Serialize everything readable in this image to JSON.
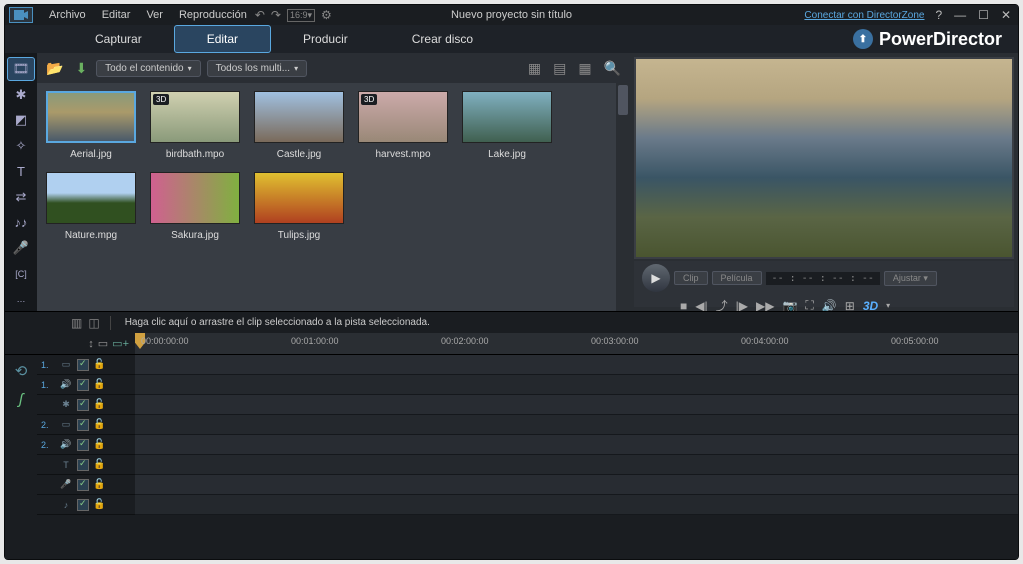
{
  "menu": {
    "archivo": "Archivo",
    "editar": "Editar",
    "ver": "Ver",
    "reproduccion": "Reproducción"
  },
  "title": "Nuevo proyecto sin título",
  "link_dz": "Conectar con DirectorZone",
  "modes": {
    "capturar": "Capturar",
    "editar": "Editar",
    "producir": "Producir",
    "crear_disco": "Crear disco"
  },
  "brand": "PowerDirector",
  "filters": {
    "content": "Todo el contenido",
    "media": "Todos los multi..."
  },
  "thumbs": [
    {
      "label": "Aerial.jpg",
      "cls": "g-aerial",
      "selected": true,
      "threeD": false
    },
    {
      "label": "birdbath.mpo",
      "cls": "g-bird",
      "selected": false,
      "threeD": true
    },
    {
      "label": "Castle.jpg",
      "cls": "g-castle",
      "selected": false,
      "threeD": false
    },
    {
      "label": "harvest.mpo",
      "cls": "g-harvest",
      "selected": false,
      "threeD": true
    },
    {
      "label": "Lake.jpg",
      "cls": "g-lake",
      "selected": false,
      "threeD": false
    },
    {
      "label": "Nature.mpg",
      "cls": "g-nature",
      "selected": false,
      "threeD": false
    },
    {
      "label": "Sakura.jpg",
      "cls": "g-sakura",
      "selected": false,
      "threeD": false
    },
    {
      "label": "Tulips.jpg",
      "cls": "g-tulips",
      "selected": false,
      "threeD": false
    }
  ],
  "preview": {
    "clip": "Clip",
    "pelicula": "Película",
    "time": "-- : -- : -- : --",
    "ajustar": "Ajustar",
    "threeD": "3D"
  },
  "hint": "Haga clic aquí o arrastre el clip seleccionado a la pista seleccionada.",
  "ruler": [
    "00:00:00:00",
    "00:01:00:00",
    "00:02:00:00",
    "00:03:00:00",
    "00:04:00:00",
    "00:05:00:00"
  ],
  "tracks": [
    {
      "num": "1.",
      "icon": "▭"
    },
    {
      "num": "1.",
      "icon": "🔊"
    },
    {
      "num": "",
      "icon": "✱"
    },
    {
      "num": "2.",
      "icon": "▭"
    },
    {
      "num": "2.",
      "icon": "🔊"
    },
    {
      "num": "",
      "icon": "T"
    },
    {
      "num": "",
      "icon": "🎤"
    },
    {
      "num": "",
      "icon": "♪"
    }
  ]
}
